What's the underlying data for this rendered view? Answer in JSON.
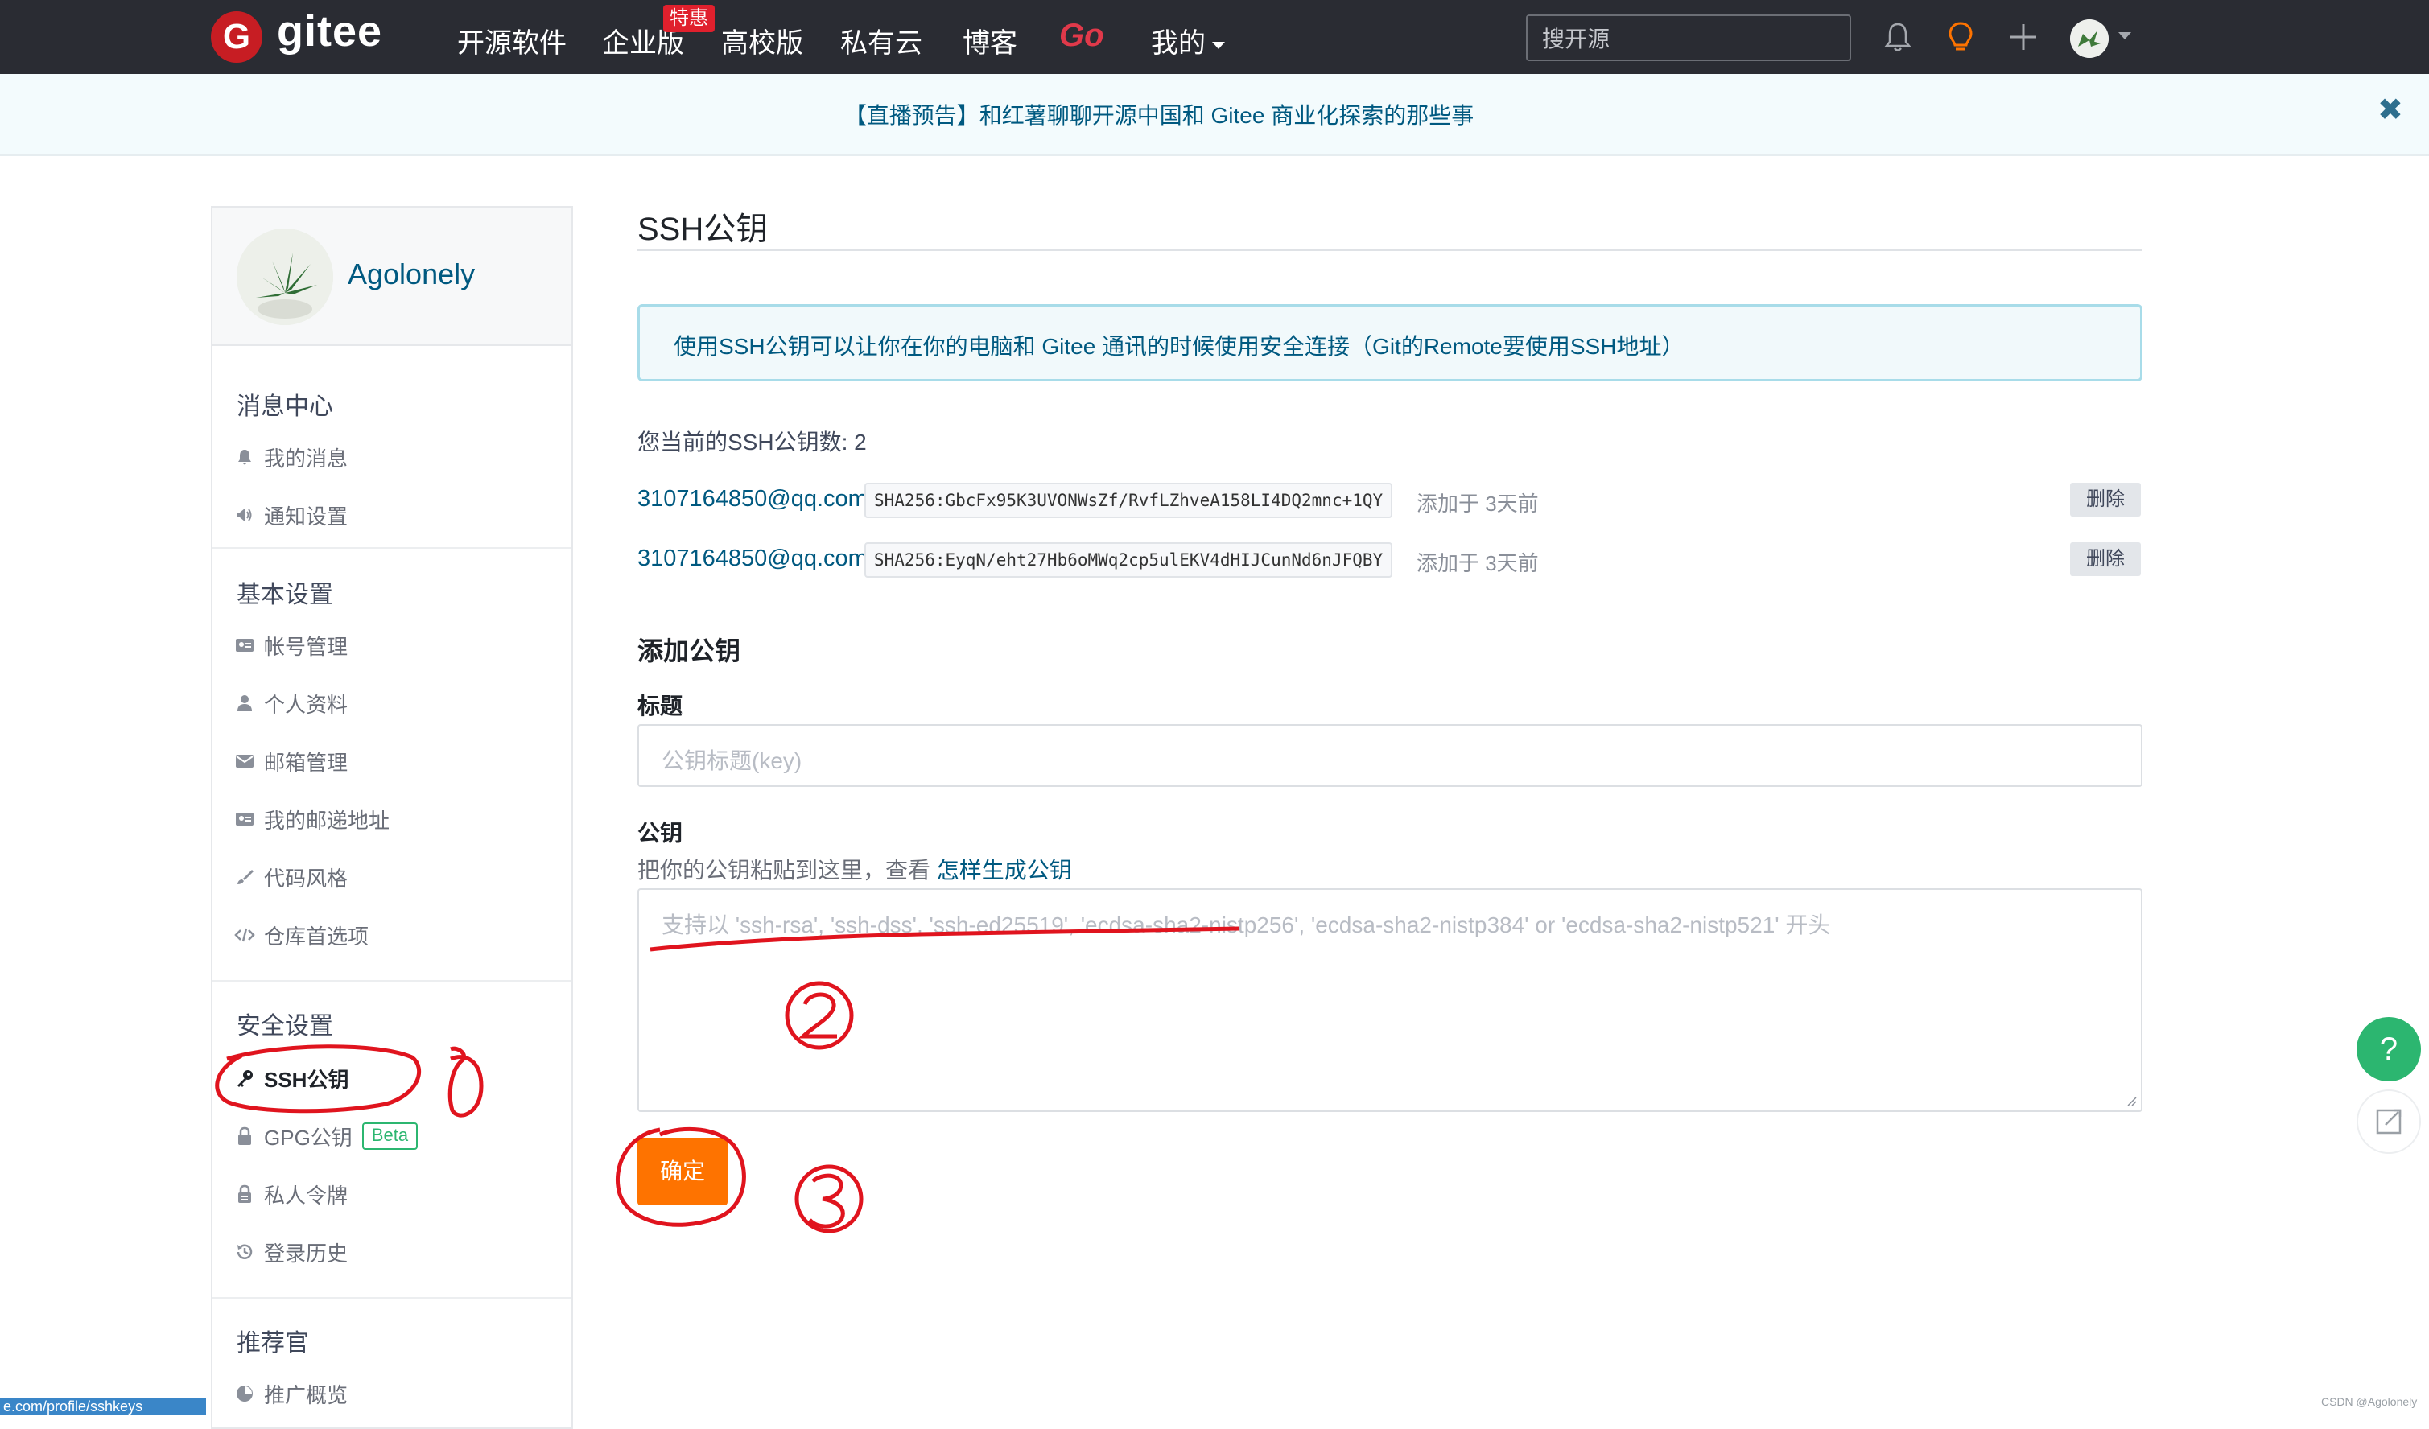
{
  "nav": {
    "logo_text": "gitee",
    "items": [
      "开源软件",
      "企业版",
      "高校版",
      "私有云",
      "博客"
    ],
    "go_label": "Go",
    "mine_label": "我的",
    "badge": "特惠",
    "search_placeholder": "搜开源"
  },
  "banner": {
    "text": "【直播预告】和红薯聊聊开源中国和 Gitee 商业化探索的那些事",
    "close": "✖"
  },
  "sidebar": {
    "username": "Agolonely",
    "sections": [
      {
        "title": "消息中心",
        "items": [
          {
            "label": "我的消息",
            "icon": "bell-icon"
          },
          {
            "label": "通知设置",
            "icon": "speaker-icon"
          }
        ]
      },
      {
        "title": "基本设置",
        "items": [
          {
            "label": "帐号管理",
            "icon": "id-card-icon"
          },
          {
            "label": "个人资料",
            "icon": "user-icon"
          },
          {
            "label": "邮箱管理",
            "icon": "envelope-icon"
          },
          {
            "label": "我的邮递地址",
            "icon": "address-card-icon"
          },
          {
            "label": "代码风格",
            "icon": "brush-icon"
          },
          {
            "label": "仓库首选项",
            "icon": "code-icon"
          }
        ]
      },
      {
        "title": "安全设置",
        "items": [
          {
            "label": "SSH公钥",
            "icon": "key-icon",
            "active": true
          },
          {
            "label": "GPG公钥",
            "icon": "lock-icon",
            "badge": "Beta"
          },
          {
            "label": "私人令牌",
            "icon": "token-icon"
          },
          {
            "label": "登录历史",
            "icon": "history-icon"
          }
        ]
      },
      {
        "title": "推荐官",
        "items": [
          {
            "label": "推广概览",
            "icon": "chart-icon"
          }
        ]
      }
    ]
  },
  "main": {
    "title": "SSH公钥",
    "info": "使用SSH公钥可以让你在你的电脑和 Gitee 通讯的时候使用安全连接（Git的Remote要使用SSH地址）",
    "count_text": "您当前的SSH公钥数: 2",
    "keys": [
      {
        "email": "3107164850@qq.com",
        "fingerprint": "SHA256:GbcFx95K3UVONWsZf/RvfLZhveA158LI4DQ2mnc+1QY",
        "added": "添加于 3天前",
        "delete": "删除"
      },
      {
        "email": "3107164850@qq.com",
        "fingerprint": "SHA256:EyqN/eht27Hb6oMWq2cp5ulEKV4dHIJCunNd6nJFQBY",
        "added": "添加于 3天前",
        "delete": "删除"
      }
    ],
    "add_heading": "添加公钥",
    "title_label": "标题",
    "title_placeholder": "公钥标题(key)",
    "key_label": "公钥",
    "help_text": "把你的公钥粘贴到这里，查看",
    "help_link": "怎样生成公钥",
    "key_placeholder": "支持以 'ssh-rsa', 'ssh-dss', 'ssh-ed25519', 'ecdsa-sha2-nistp256', 'ecdsa-sha2-nistp384' or 'ecdsa-sha2-nistp521' 开头",
    "confirm": "确定"
  },
  "floating": {
    "help": "?"
  },
  "status_url": "e.com/profile/sshkeys",
  "watermark": "CSDN @Agolonely",
  "colors": {
    "brand_red": "#c71d23",
    "accent_orange": "#fe7300",
    "link_blue": "#005980",
    "nav_bg": "#2a2c33",
    "annotation_red": "#e0141e"
  }
}
